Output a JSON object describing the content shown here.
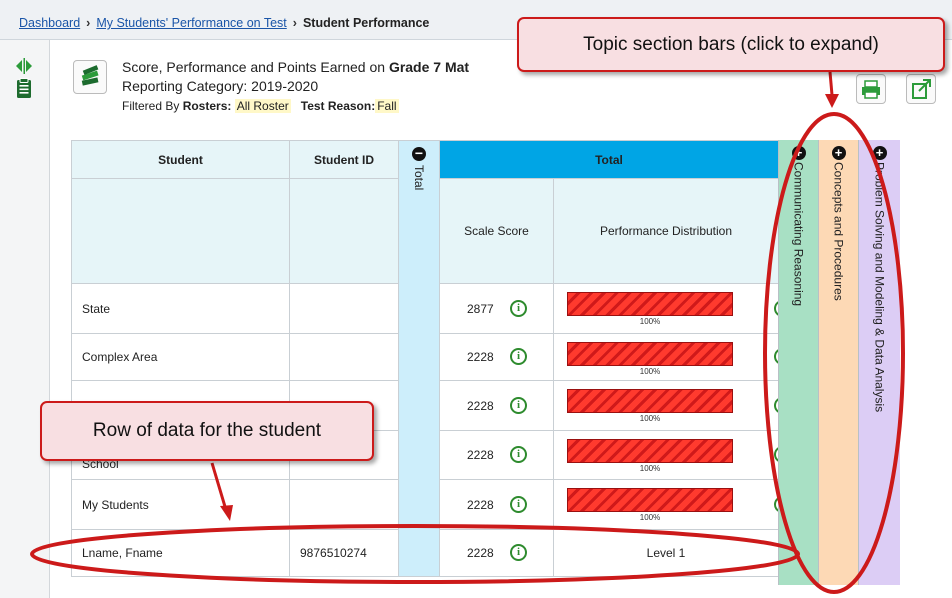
{
  "breadcrumb": {
    "home": "Dashboard",
    "parent": "My Students' Performance on Test",
    "current": "Student Performance"
  },
  "header": {
    "line1_prefix": "Score, Performance and Points Earned on ",
    "line1_bold": "Grade 7 Mat",
    "line2": "Reporting Category: 2019-2020",
    "filter_label": "Filtered By ",
    "rosters_label": "Rosters:",
    "rosters_value": "All Roster",
    "reason_label": "Test Reason:",
    "reason_value": "Fall"
  },
  "table": {
    "col_student": "Student",
    "col_student_id": "Student ID",
    "col_total_collapsed": "Total",
    "col_total_group": "Total",
    "col_scale_score": "Scale Score",
    "col_perf_dist": "Performance Distribution",
    "rows": [
      {
        "name": "State",
        "id": "",
        "score": "2877",
        "perf": "100%"
      },
      {
        "name": "Complex Area",
        "id": "",
        "score": "2228",
        "perf": "100%"
      },
      {
        "name": "",
        "id": "",
        "score": "2228",
        "perf": "100%"
      },
      {
        "name": "School",
        "id": "",
        "score": "2228",
        "perf": "100%"
      },
      {
        "name": "My Students",
        "id": "",
        "score": "2228",
        "perf": "100%"
      }
    ],
    "student_row": {
      "name": "Lname, Fname",
      "id": "9876510274",
      "score": "2228",
      "perf": "Level 1"
    }
  },
  "topics": [
    {
      "label": "Communicating Reasoning",
      "color": "#a8e0c4"
    },
    {
      "label": "Concepts and Procedures",
      "color": "#fdd9b5"
    },
    {
      "label": "Problem Solving and Modeling & Data Analysis",
      "color": "#dccdf5"
    }
  ],
  "annotations": {
    "topic_callout": "Topic section bars (click to expand)",
    "row_callout": "Row of data for the student"
  },
  "icons": {
    "info": "info-circle-icon",
    "plus": "plus-circle-icon",
    "minus": "minus-circle-icon"
  },
  "colors": {
    "accent_blue": "#00a5e5",
    "annotation_red": "#cc1a1a",
    "bar_red": "#ff3a2e"
  }
}
